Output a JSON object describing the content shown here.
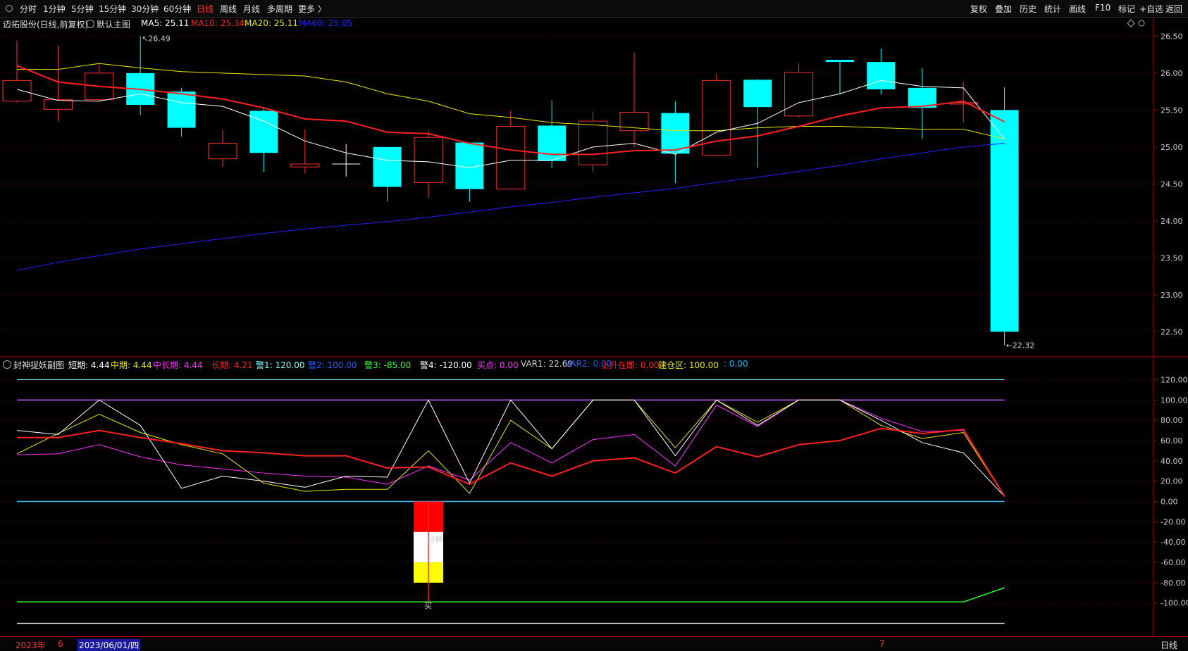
{
  "toolbar": {
    "left_items": [
      {
        "label": "分时",
        "color": "#e6e6e6"
      },
      {
        "label": "1分钟",
        "color": "#e6e6e6"
      },
      {
        "label": "5分钟",
        "color": "#e6e6e6"
      },
      {
        "label": "15分钟",
        "color": "#e6e6e6"
      },
      {
        "label": "30分钟",
        "color": "#e6e6e6"
      },
      {
        "label": "60分钟",
        "color": "#e6e6e6"
      },
      {
        "label": "日线",
        "color": "#ff3030"
      },
      {
        "label": "周线",
        "color": "#e6e6e6"
      },
      {
        "label": "月线",
        "color": "#e6e6e6"
      },
      {
        "label": "多周期",
        "color": "#e6e6e6"
      },
      {
        "label": "更多 〉",
        "color": "#e6e6e6"
      }
    ],
    "right_items": [
      "复权",
      "叠加",
      "历史",
      "统计",
      "画线",
      "F10",
      "标记",
      "+自选",
      "返回"
    ]
  },
  "main_chart": {
    "title": "迈拓股份(日线,前复权)",
    "main_label": "默认主图",
    "ma5": {
      "label": "MA5: 25.11",
      "color": "#ffffff"
    },
    "ma10": {
      "label": "MA10: 25.34",
      "color": "#ff2020"
    },
    "ma20": {
      "label": "MA20: 25.11",
      "color": "#e8e800"
    },
    "ma60": {
      "label": "MA60: 25.05",
      "color": "#2020ff"
    },
    "high_label": "26.49",
    "low_label": "22.32",
    "up_color": "#ff3030",
    "down_color": "#00ffff",
    "y_ticks": [
      "26.50",
      "26.00",
      "25.50",
      "25.00",
      "24.50",
      "24.00",
      "23.50",
      "23.00",
      "22.50"
    ]
  },
  "sub_chart": {
    "title": "封神捉妖副图",
    "params": [
      {
        "label": "短期: 4.44",
        "color": "#ffffff"
      },
      {
        "label": "中期: 4.44",
        "color": "#e8e800"
      },
      {
        "label": "中长期: 4.44",
        "color": "#ff30ff"
      },
      {
        "label": "长期: 4.21",
        "color": "#ff2020"
      },
      {
        "label": "警1: 120.00",
        "color": "#80ffff"
      },
      {
        "label": "警2: 100.00",
        "color": "#2060ff"
      },
      {
        "label": "警3: -85.00",
        "color": "#30ff30"
      },
      {
        "label": "警4: -120.00",
        "color": "#ffffff"
      },
      {
        "label": "买点: 0.00",
        "color": "#ff30ff"
      },
      {
        "label": "VAR1: 22.69",
        "color": "#d0d0d0"
      },
      {
        "label": "VAR2: 0.00",
        "color": "#2060ff"
      },
      {
        "label": "上升在即: 0.00",
        "color": "#ff2020"
      },
      {
        "label": "建仓区: 100.00",
        "color": "#e8e800"
      },
      {
        "label": ": 0.00",
        "color": "#00c0ff"
      }
    ],
    "y_ticks": [
      "120.00",
      "100.00",
      "80.00",
      "60.00",
      "40.00",
      "20.00",
      "0.00",
      "-20.00",
      "-40.00",
      "-60.00",
      "-80.00",
      "-100.00"
    ],
    "signal_text": "封神",
    "buy_text": "买"
  },
  "bottom_bar": {
    "year": "2023年",
    "month6": "6",
    "date": "2023/06/01/四",
    "month7": "7",
    "period": "日线"
  },
  "chart_data": {
    "type": "candlestick",
    "candles": [
      {
        "o": 25.62,
        "c": 25.9,
        "h": 26.44,
        "l": 25.6
      },
      {
        "o": 25.51,
        "c": 25.64,
        "h": 26.37,
        "l": 25.35
      },
      {
        "o": 25.64,
        "c": 26.0,
        "h": 26.13,
        "l": 25.61
      },
      {
        "o": 26.0,
        "c": 25.57,
        "h": 26.5,
        "l": 25.43
      },
      {
        "o": 25.75,
        "c": 25.26,
        "h": 25.8,
        "l": 25.14
      },
      {
        "o": 24.84,
        "c": 25.05,
        "h": 25.23,
        "l": 24.73
      },
      {
        "o": 25.49,
        "c": 24.92,
        "h": 25.54,
        "l": 24.66
      },
      {
        "o": 24.73,
        "c": 24.77,
        "h": 25.24,
        "l": 24.64
      },
      {
        "o": 24.77,
        "c": 24.77,
        "h": 25.04,
        "l": 24.6
      },
      {
        "o": 25.0,
        "c": 24.46,
        "h": 25.0,
        "l": 24.26
      },
      {
        "o": 24.52,
        "c": 25.13,
        "h": 25.23,
        "l": 24.31
      },
      {
        "o": 25.06,
        "c": 24.43,
        "h": 25.05,
        "l": 24.26
      },
      {
        "o": 24.43,
        "c": 25.28,
        "h": 25.49,
        "l": 24.43
      },
      {
        "o": 25.29,
        "c": 24.81,
        "h": 25.63,
        "l": 24.71
      },
      {
        "o": 24.76,
        "c": 25.35,
        "h": 25.48,
        "l": 24.66
      },
      {
        "o": 25.22,
        "c": 25.47,
        "h": 26.28,
        "l": 25.0
      },
      {
        "o": 25.46,
        "c": 24.91,
        "h": 25.62,
        "l": 24.51
      },
      {
        "o": 24.89,
        "c": 25.9,
        "h": 25.99,
        "l": 24.89
      },
      {
        "o": 25.91,
        "c": 25.54,
        "h": 25.92,
        "l": 24.72
      },
      {
        "o": 25.42,
        "c": 26.01,
        "h": 26.13,
        "l": 25.4
      },
      {
        "o": 26.18,
        "c": 26.15,
        "h": 26.18,
        "l": 25.71
      },
      {
        "o": 26.15,
        "c": 25.78,
        "h": 26.33,
        "l": 25.71
      },
      {
        "o": 25.8,
        "c": 25.53,
        "h": 26.07,
        "l": 25.11
      },
      {
        "o": 25.6,
        "c": 25.6,
        "h": 25.88,
        "l": 25.33
      },
      {
        "o": 25.5,
        "c": 22.5,
        "h": 25.81,
        "l": 22.32
      }
    ],
    "ma5": [
      25.78,
      25.63,
      25.62,
      25.72,
      25.6,
      25.55,
      25.35,
      25.08,
      24.92,
      24.82,
      24.8,
      24.72,
      24.82,
      24.82,
      25.0,
      25.05,
      24.9,
      25.2,
      25.32,
      25.6,
      25.72,
      25.9,
      25.82,
      25.8,
      25.11
    ],
    "ma10": [
      26.1,
      25.88,
      25.82,
      25.78,
      25.72,
      25.65,
      25.53,
      25.38,
      25.35,
      25.2,
      25.18,
      25.05,
      24.96,
      24.9,
      24.9,
      24.95,
      24.96,
      25.08,
      25.15,
      25.28,
      25.42,
      25.53,
      25.55,
      25.62,
      25.34
    ],
    "ma20": [
      26.05,
      26.05,
      26.13,
      26.07,
      26.02,
      26.0,
      25.98,
      25.96,
      25.88,
      25.72,
      25.62,
      25.45,
      25.4,
      25.33,
      25.3,
      25.26,
      25.22,
      25.22,
      25.26,
      25.28,
      25.28,
      25.26,
      25.24,
      25.24,
      25.11
    ],
    "ma60": [
      23.33,
      23.44,
      23.53,
      23.62,
      23.69,
      23.76,
      23.83,
      23.89,
      23.94,
      23.99,
      24.05,
      24.12,
      24.19,
      24.25,
      24.32,
      24.38,
      24.44,
      24.52,
      24.59,
      24.67,
      24.75,
      24.84,
      24.92,
      25.0,
      25.05
    ],
    "sub_series": {
      "short": [
        70,
        66,
        100,
        75,
        13,
        25,
        20,
        14,
        25,
        24,
        100,
        18,
        100,
        52,
        100,
        100,
        45,
        100,
        75,
        100,
        100,
        80,
        58,
        48,
        5
      ],
      "mid": [
        47,
        67,
        86,
        68,
        56,
        47,
        18,
        10,
        12,
        12,
        50,
        8,
        80,
        52,
        100,
        100,
        53,
        100,
        78,
        100,
        100,
        75,
        62,
        68,
        5
      ],
      "midlong": [
        46,
        47,
        56,
        44,
        36,
        32,
        28,
        25,
        24,
        17,
        35,
        21,
        58,
        38,
        61,
        66,
        35,
        95,
        74,
        100,
        100,
        82,
        69,
        70,
        5
      ],
      "long": [
        63,
        63,
        70,
        63,
        57,
        50,
        48,
        45,
        45,
        33,
        34,
        17,
        38,
        25,
        40,
        43,
        28,
        54,
        44,
        56,
        60,
        72,
        67,
        71,
        5
      ],
      "warn3": [
        -99,
        -99,
        -99,
        -99,
        -99,
        -99,
        -99,
        -99,
        -99,
        -99,
        -99,
        -99,
        -99,
        -99,
        -99,
        -99,
        -99,
        -99,
        -99,
        -99,
        -99,
        -99,
        -99,
        -99,
        -85
      ],
      "warn1": 120,
      "warn2": 100,
      "warn4": -120,
      "zero": 0
    },
    "signal_bar": {
      "index": 10,
      "red_from": 0,
      "red_to": -30,
      "white_from": -30,
      "white_to": -60,
      "yellow_from": -60,
      "yellow_to": -80
    }
  }
}
